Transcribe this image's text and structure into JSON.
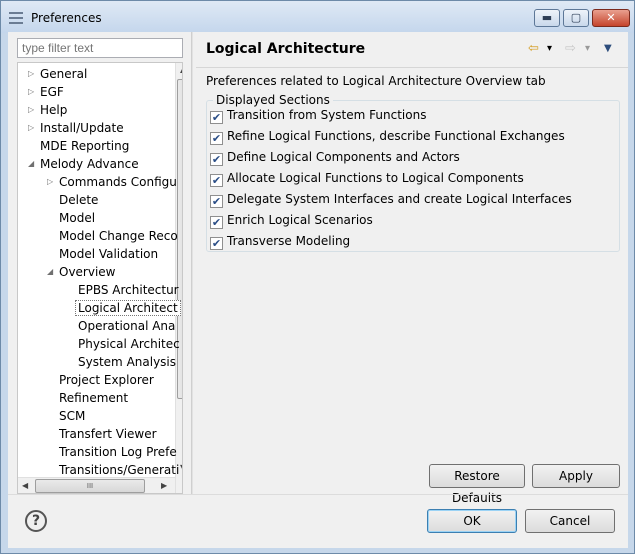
{
  "window": {
    "title": "Preferences",
    "controls": {
      "minimize": "▬",
      "maximize": "▢",
      "close": "✕"
    }
  },
  "filter": {
    "placeholder": "type filter text"
  },
  "tree": {
    "items": [
      {
        "label": "General",
        "expander": "▷",
        "depth": 0
      },
      {
        "label": "EGF",
        "expander": "▷",
        "depth": 0
      },
      {
        "label": "Help",
        "expander": "▷",
        "depth": 0
      },
      {
        "label": "Install/Update",
        "expander": "▷",
        "depth": 0
      },
      {
        "label": "MDE Reporting",
        "expander": "",
        "depth": 0
      },
      {
        "label": "Melody Advance",
        "expander": "◢",
        "depth": 0
      },
      {
        "label": "Commands Configu",
        "expander": "▷",
        "depth": 1
      },
      {
        "label": "Delete",
        "expander": "",
        "depth": 1
      },
      {
        "label": "Model",
        "expander": "",
        "depth": 1
      },
      {
        "label": "Model Change Reco",
        "expander": "",
        "depth": 1
      },
      {
        "label": "Model Validation",
        "expander": "",
        "depth": 1
      },
      {
        "label": "Overview",
        "expander": "◢",
        "depth": 1
      },
      {
        "label": "EPBS Architectur",
        "expander": "",
        "depth": 2
      },
      {
        "label": "Logical Architect",
        "expander": "",
        "depth": 2,
        "selected": true
      },
      {
        "label": "Operational Ana",
        "expander": "",
        "depth": 2
      },
      {
        "label": "Physical Architec",
        "expander": "",
        "depth": 2
      },
      {
        "label": "System Analysis",
        "expander": "",
        "depth": 2
      },
      {
        "label": "Project Explorer",
        "expander": "",
        "depth": 1
      },
      {
        "label": "Refinement",
        "expander": "",
        "depth": 1
      },
      {
        "label": "SCM",
        "expander": "",
        "depth": 1
      },
      {
        "label": "Transfert Viewer",
        "expander": "",
        "depth": 1
      },
      {
        "label": "Transition Log Prefe",
        "expander": "",
        "depth": 1
      },
      {
        "label": "Transitions/Generati",
        "expander": "",
        "depth": 1
      }
    ],
    "hscroll_grip": "III"
  },
  "page": {
    "title": "Logical Architecture",
    "description": "Preferences related to Logical Architecture Overview tab",
    "group_label": "Displayed Sections",
    "sections": [
      {
        "label": "Transition from System Functions",
        "checked": true
      },
      {
        "label": "Refine Logical Functions, describe Functional Exchanges",
        "checked": true
      },
      {
        "label": "Define Logical Components and Actors",
        "checked": true
      },
      {
        "label": "Allocate Logical Functions to Logical Components",
        "checked": true
      },
      {
        "label": "Delegate System Interfaces and create Logical Interfaces",
        "checked": true
      },
      {
        "label": "Enrich Logical Scenarios",
        "checked": true
      },
      {
        "label": "Transverse Modeling",
        "checked": true
      }
    ],
    "check_glyph": "✔"
  },
  "nav": {
    "back": "⇦",
    "forward": "⇨",
    "dropdown": "▾",
    "menu": "▼"
  },
  "buttons": {
    "restore_defaults": "Restore Defaults",
    "apply": "Apply",
    "ok": "OK",
    "cancel": "Cancel",
    "help": "?"
  },
  "colors": {
    "accent": "#3c7fb1",
    "title_bar": "#c4d6ec",
    "close_button": "#c5442c"
  }
}
